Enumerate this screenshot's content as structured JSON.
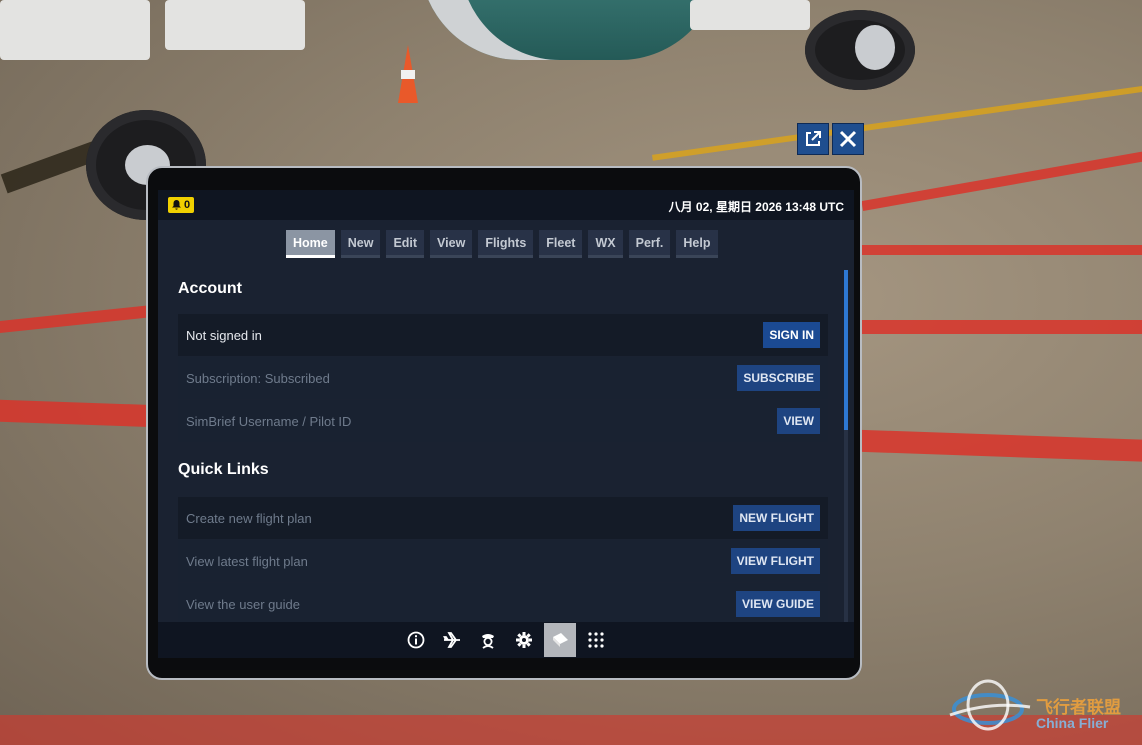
{
  "status": {
    "notification_count": "0",
    "datetime": "八月 02, 星期日 2026 13:48 UTC"
  },
  "tabs": [
    {
      "label": "Home",
      "active": true
    },
    {
      "label": "New"
    },
    {
      "label": "Edit"
    },
    {
      "label": "View"
    },
    {
      "label": "Flights"
    },
    {
      "label": "Fleet"
    },
    {
      "label": "WX"
    },
    {
      "label": "Perf."
    },
    {
      "label": "Help"
    }
  ],
  "account": {
    "title": "Account",
    "rows": [
      {
        "label": "Not signed in",
        "action": "SIGN IN"
      },
      {
        "label": "Subscription: Subscribed",
        "action": "SUBSCRIBE"
      },
      {
        "label": "SimBrief Username / Pilot ID",
        "action": "VIEW"
      }
    ]
  },
  "quick_links": {
    "title": "Quick Links",
    "rows": [
      {
        "label": "Create new flight plan",
        "action": "NEW FLIGHT"
      },
      {
        "label": "View latest flight plan",
        "action": "VIEW FLIGHT"
      },
      {
        "label": "View the user guide",
        "action": "VIEW GUIDE"
      }
    ]
  },
  "bottom_nav": [
    "info-icon",
    "plane-icon",
    "pilot-icon",
    "gear-icon",
    "clipboard-icon",
    "apps-grid-icon"
  ],
  "watermark": {
    "text": "飞行者联盟",
    "subtext": "China Flier"
  },
  "colors": {
    "accent": "#1e4481",
    "badge": "#f0d000",
    "scroll": "#2e78d2"
  }
}
